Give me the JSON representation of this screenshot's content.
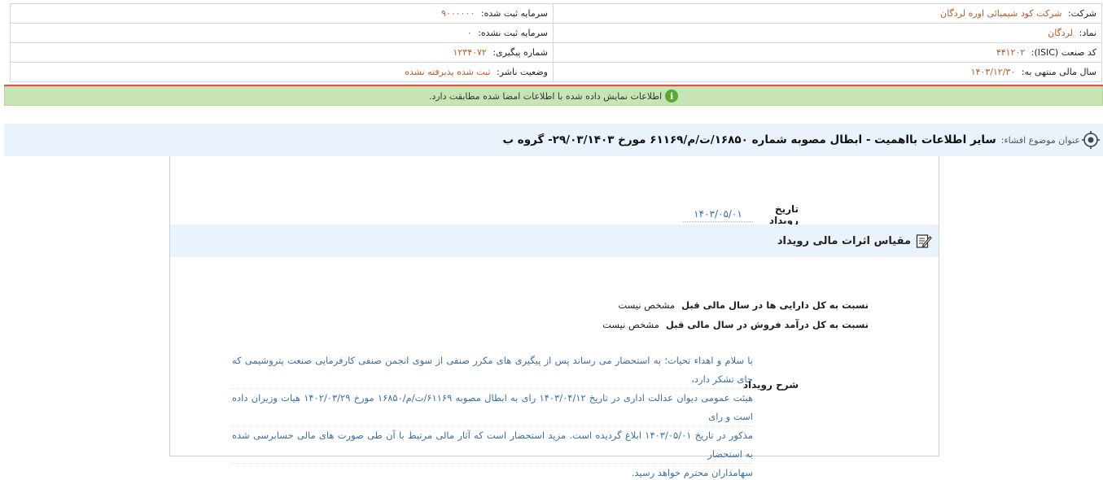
{
  "company_info": {
    "company_label": "شرکت:",
    "company_value": "شرکت کود شیمیائی اوره لردگان",
    "registered_capital_label": "سرمایه ثبت شده:",
    "registered_capital_value": "۹۰۰۰۰۰۰",
    "symbol_label": "نماد:",
    "symbol_value": "لردگان",
    "unregistered_capital_label": "سرمایه ثبت نشده:",
    "unregistered_capital_value": "۰",
    "isic_label": "کد صنعت (ISIC):",
    "isic_value": "۴۴۱۲۰۲",
    "tracking_label": "شماره پیگیری:",
    "tracking_value": "۱۲۳۴۰۷۲",
    "fiscal_year_label": "سال مالی منتهی به:",
    "fiscal_year_value": "۱۴۰۳/۱۲/۳۰",
    "publisher_status_label": "وضعیت ناشر:",
    "publisher_status_value": "ثبت شده پذیرفته نشده"
  },
  "notice": {
    "icon": "info-icon",
    "message": "اطلاعات نمایش داده شده با اطلاعات امضا شده مطابقت دارد."
  },
  "disclosure": {
    "title_label": "عنوان موضوع افشاء:",
    "title_value": "سایر اطلاعات بااهمیت - ابطال مصوبه شماره ۱۶۸۵۰/ت/م/۶۱۱۶۹ مورخ ۲۹/۰۳/۱۴۰۳- گروه ب"
  },
  "event": {
    "date_label": "تاریخ رویداد",
    "date_value": "۱۴۰۳/۰۵/۰۱",
    "section_title": "مقیاس اثرات مالی رویداد",
    "ratio_assets_label": "نسبت به کل دارایی ها در سال مالی قبل",
    "ratio_assets_value": "مشخص نیست",
    "ratio_revenue_label": "نسبت به کل درآمد فروش در سال مالی قبل",
    "ratio_revenue_value": "مشخص نیست",
    "description_label": "شرح رویداد",
    "description_lines": [
      "با سلام و اهداء تحیات؛ به استحضار می رساند پس از پیگیری های مکرر صنفی از سوی انجمن صنفی کارفرمایی صنعت پتروشیمی که جای تشکر دارد،",
      "هیئت عمومی دیوان عدالت اداری در تاریخ ۱۴۰۳/۰۴/۱۲ رای به ابطال مصوبه ۶۱۱۶۹/ت/م/۱۶۸۵۰ مورخ ۱۴۰۲/۰۳/۲۹ هیات وزیران داده است و رای",
      "مذکور در تاریخ ۱۴۰۳/۰۵/۰۱ ابلاغ گردیده است. مزید استحضار است که آثار مالی مرتبط با آن طی صورت های مالی حسابرسی شده به استحضار",
      "سهامداران محترم خواهد رسید."
    ]
  }
}
